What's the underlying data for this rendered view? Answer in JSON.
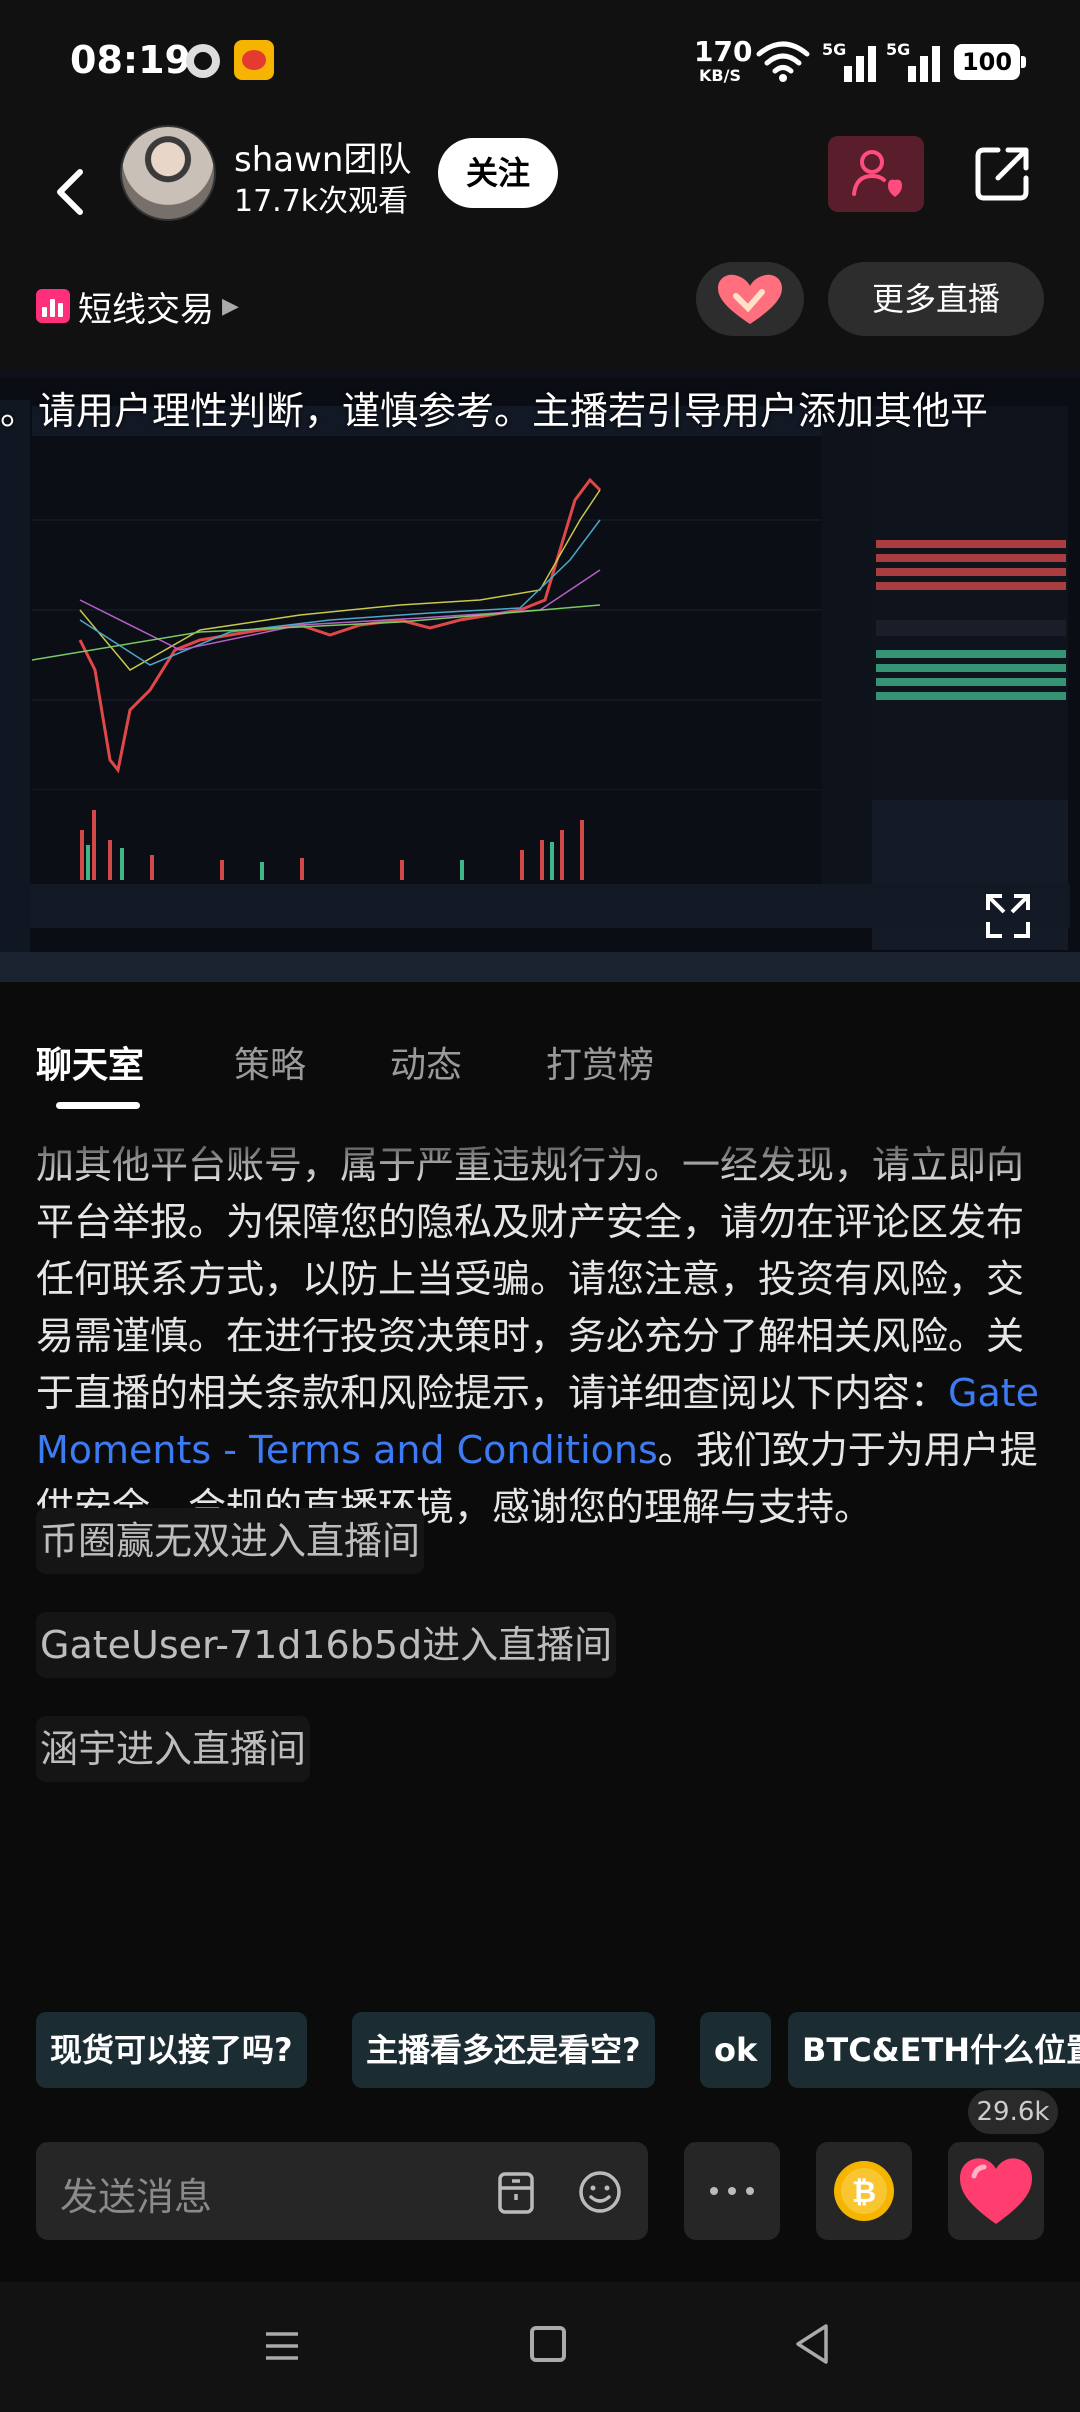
{
  "status_bar": {
    "time": "08:19",
    "net_speed": "170",
    "net_unit": "KB/S",
    "signal1_label": "5G",
    "signal2_label": "5G",
    "battery": "100"
  },
  "header": {
    "host_name": "shawn团队",
    "views": "17.7k次观看",
    "follow_label": "关注",
    "category": "短线交易",
    "more_live_label": "更多直播"
  },
  "video": {
    "marquee": "。请用户理性判断，谨慎参考。主播若引导用户添加其他平"
  },
  "tabs": [
    {
      "label": "聊天室",
      "active": true
    },
    {
      "label": "策略",
      "active": false
    },
    {
      "label": "动态",
      "active": false
    },
    {
      "label": "打赏榜",
      "active": false
    }
  ],
  "notice": {
    "faded_line": "… 请用户理性判断，谨慎参考。主播若引导用户添",
    "text": "加其他平台账号，属于严重违规行为。一经发现，请立即向平台举报。为保障您的隐私及财产安全，请勿在评论区发布任何联系方式，以防上当受骗。请您注意，投资有风险，交易需谨慎。在进行投资决策时，务必充分了解相关风险。关于直播的相关条款和风险提示，请详细查阅以下内容：",
    "link": "Gate Moments - Terms and Conditions",
    "tail": "。我们致力于为用户提供安全、合规的直播环境，感谢您的理解与支持。"
  },
  "system_messages": [
    "币圈赢无双进入直播间",
    "GateUser-71d16b5d进入直播间",
    "涵宇进入直播间"
  ],
  "quick_replies": [
    "现货可以接了吗?",
    "主播看多还是看空?",
    "ok",
    "BTC&ETH什么位置"
  ],
  "input": {
    "placeholder": "发送消息",
    "like_count": "29.6k"
  },
  "colors": {
    "link": "#3d7bf5",
    "follow_bg": "#ffffff",
    "fan_bg": "#5a1d2c",
    "category_accent": "#ff2f7c",
    "like_heart": "#ff3d6e",
    "coin": "#f4b400"
  }
}
